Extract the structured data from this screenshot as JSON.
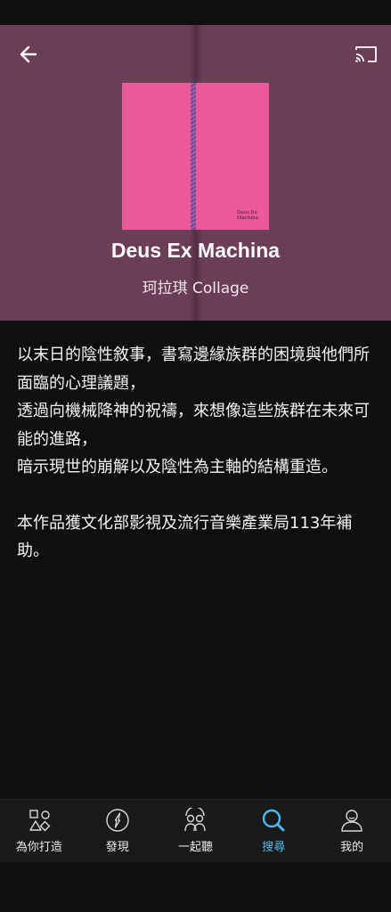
{
  "album": {
    "title": "Deus Ex Machina",
    "artist_line": "珂拉琪 Collage",
    "cover_text_line1": "Deus Ex",
    "cover_text_line2": "Machina",
    "cover_color": "#e85a9a",
    "hero_color": "#6a3f56"
  },
  "header": {
    "back_icon": "arrow-left-icon",
    "cast_icon": "cast-icon"
  },
  "description": {
    "lines": [
      "以末日的陰性敘事，書寫邊緣族群的困境與他們所面臨的心理議題，",
      "透過向機械降神的祝禱，來想像這些族群在未來可能的進路，",
      "暗示現世的崩解以及陰性為主軸的結構重造。",
      "本作品獲文化部影視及流行音樂產業局113年補助。"
    ]
  },
  "nav": {
    "items": [
      {
        "label": "為你打造",
        "icon": "made-for-you-icon",
        "active": false
      },
      {
        "label": "發現",
        "icon": "compass-icon",
        "active": false
      },
      {
        "label": "一起聽",
        "icon": "listen-together-icon",
        "active": false
      },
      {
        "label": "搜尋",
        "icon": "search-icon",
        "active": true
      },
      {
        "label": "我的",
        "icon": "profile-icon",
        "active": false
      }
    ],
    "active_color": "#4fb8e8"
  }
}
